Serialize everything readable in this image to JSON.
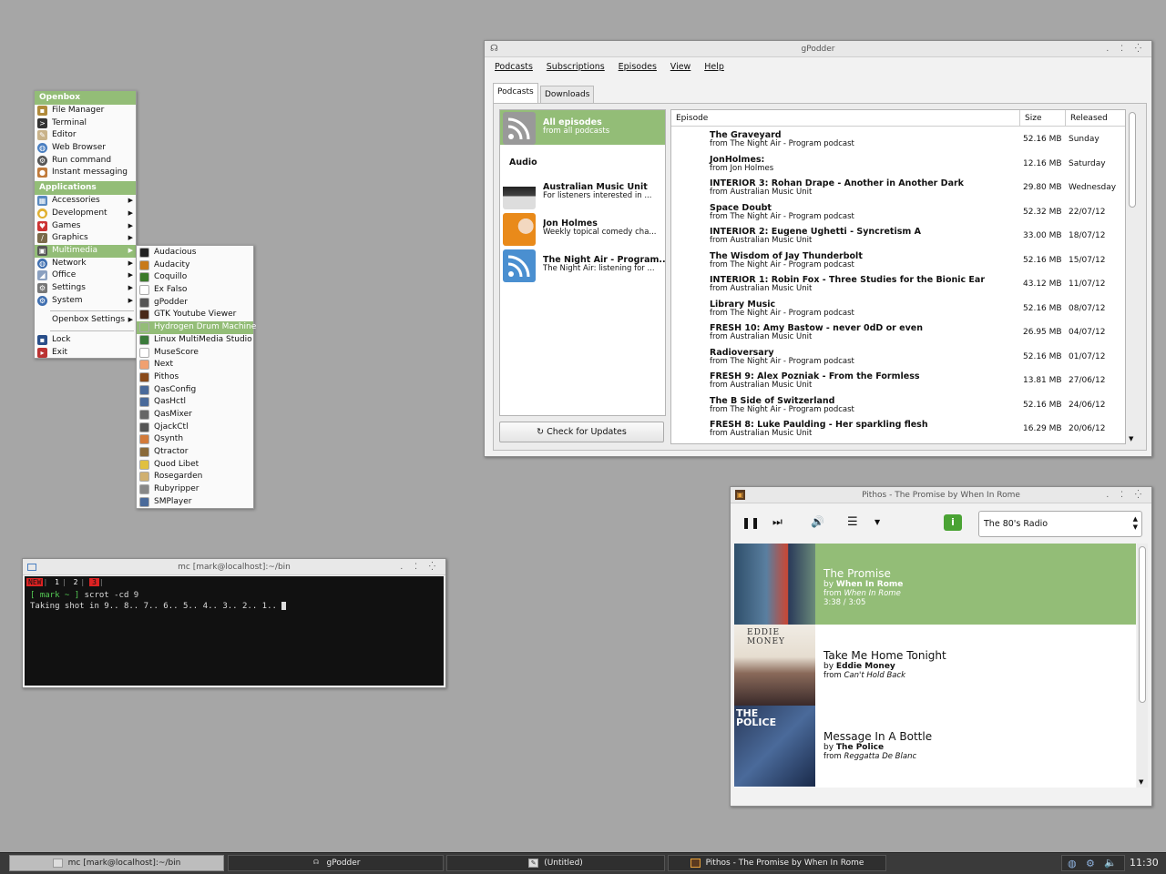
{
  "openbox_menu": {
    "header": "Openbox",
    "items": [
      "File Manager",
      "Terminal",
      "Editor",
      "Web Browser",
      "Run command",
      "Instant messaging"
    ],
    "apps_header": "Applications",
    "apps": [
      "Accessories",
      "Development",
      "Games",
      "Graphics",
      "Multimedia",
      "Network",
      "Office",
      "Settings",
      "System"
    ],
    "openbox_settings": "Openbox Settings",
    "lock": "Lock",
    "exit": "Exit"
  },
  "multimedia_menu": {
    "items": [
      "Audacious",
      "Audacity",
      "Coquillo",
      "Ex Falso",
      "gPodder",
      "GTK Youtube Viewer",
      "Hydrogen Drum Machine",
      "Linux MultiMedia Studio",
      "MuseScore",
      "Next",
      "Pithos",
      "QasConfig",
      "QasHctl",
      "QasMixer",
      "QjackCtl",
      "Qsynth",
      "Qtractor",
      "Quod Libet",
      "Rosegarden",
      "Rubyripper",
      "SMPlayer"
    ],
    "selected": "Hydrogen Drum Machine"
  },
  "gpodder": {
    "title": "gPodder",
    "menu": [
      "Podcasts",
      "Subscriptions",
      "Episodes",
      "View",
      "Help"
    ],
    "tabs": [
      "Podcasts",
      "Downloads"
    ],
    "all_episodes": {
      "title": "All episodes",
      "sub": "from all podcasts"
    },
    "section": "Audio",
    "podcasts": [
      {
        "title": "Australian Music Unit",
        "sub": "For listeners interested in ..."
      },
      {
        "title": "Jon Holmes",
        "sub": "Weekly topical comedy cha..."
      },
      {
        "title": "The Night Air - Program...",
        "sub": "The Night Air: listening for ..."
      }
    ],
    "check_button": "Check for Updates",
    "columns": [
      "Episode",
      "Size",
      "Released"
    ],
    "episodes": [
      {
        "t": "The Graveyard",
        "s": "from The Night Air - Program podcast",
        "z": "52.16 MB",
        "d": "Sunday"
      },
      {
        "t": "JonHolmes:",
        "s": "from Jon Holmes",
        "z": "12.16 MB",
        "d": "Saturday"
      },
      {
        "t": "INTERIOR 3: Rohan Drape - Another in Another Dark",
        "s": "from Australian Music Unit",
        "z": "29.80 MB",
        "d": "Wednesday"
      },
      {
        "t": "Space Doubt",
        "s": "from The Night Air - Program podcast",
        "z": "52.32 MB",
        "d": "22/07/12"
      },
      {
        "t": "INTERIOR 2: Eugene Ughetti - Syncretism A",
        "s": "from Australian Music Unit",
        "z": "33.00 MB",
        "d": "18/07/12"
      },
      {
        "t": "The Wisdom of Jay Thunderbolt",
        "s": "from The Night Air - Program podcast",
        "z": "52.16 MB",
        "d": "15/07/12"
      },
      {
        "t": "INTERIOR 1: Robin Fox - Three Studies for the Bionic Ear",
        "s": "from Australian Music Unit",
        "z": "43.12 MB",
        "d": "11/07/12"
      },
      {
        "t": "Library Music",
        "s": "from The Night Air - Program podcast",
        "z": "52.16 MB",
        "d": "08/07/12"
      },
      {
        "t": "FRESH 10: Amy Bastow - never 0dD or even",
        "s": "from Australian Music Unit",
        "z": "26.95 MB",
        "d": "04/07/12"
      },
      {
        "t": "Radioversary",
        "s": "from The Night Air - Program podcast",
        "z": "52.16 MB",
        "d": "01/07/12"
      },
      {
        "t": "FRESH 9: Alex Pozniak - From the Formless",
        "s": "from Australian Music Unit",
        "z": "13.81 MB",
        "d": "27/06/12"
      },
      {
        "t": "The B Side of Switzerland",
        "s": "from The Night Air - Program podcast",
        "z": "52.16 MB",
        "d": "24/06/12"
      },
      {
        "t": "FRESH 8: Luke Paulding - Her sparkling flesh",
        "s": "from Australian Music Unit",
        "z": "16.29 MB",
        "d": "20/06/12"
      }
    ]
  },
  "terminal": {
    "title": "mc [mark@localhost]:~/bin",
    "tabs": [
      "NEW",
      "1",
      "2",
      "3"
    ],
    "prompt": "[ mark ~ ]",
    "command": "scrot -cd 9",
    "output": "Taking shot in 9.. 8.. 7.. 6.. 5.. 4.. 3.. 2.. 1.. "
  },
  "pithos": {
    "title": "Pithos - The Promise by When In Rome",
    "station": "The 80's Radio",
    "songs": [
      {
        "title": "The Promise",
        "by": "When In Rome",
        "from": "When In Rome",
        "time": "3:38 / 3:05"
      },
      {
        "title": "Take Me Home Tonight",
        "by": "Eddie Money",
        "from": "Can't Hold Back",
        "cover_text": "EDDIE MONEY"
      },
      {
        "title": "Message In A Bottle",
        "by": "The Police",
        "from": "Reggatta De Blanc",
        "cover_text": "THE POLICE"
      }
    ],
    "by_prefix": "by",
    "from_prefix": "from"
  },
  "taskbar": {
    "tasks": [
      "mc [mark@localhost]:~/bin",
      "gPodder",
      "(Untitled)",
      "Pithos - The Promise by When In Rome"
    ],
    "clock": "11:30"
  },
  "colors": {
    "accent": "#93bd77",
    "desktop": "#a6a6a6"
  }
}
